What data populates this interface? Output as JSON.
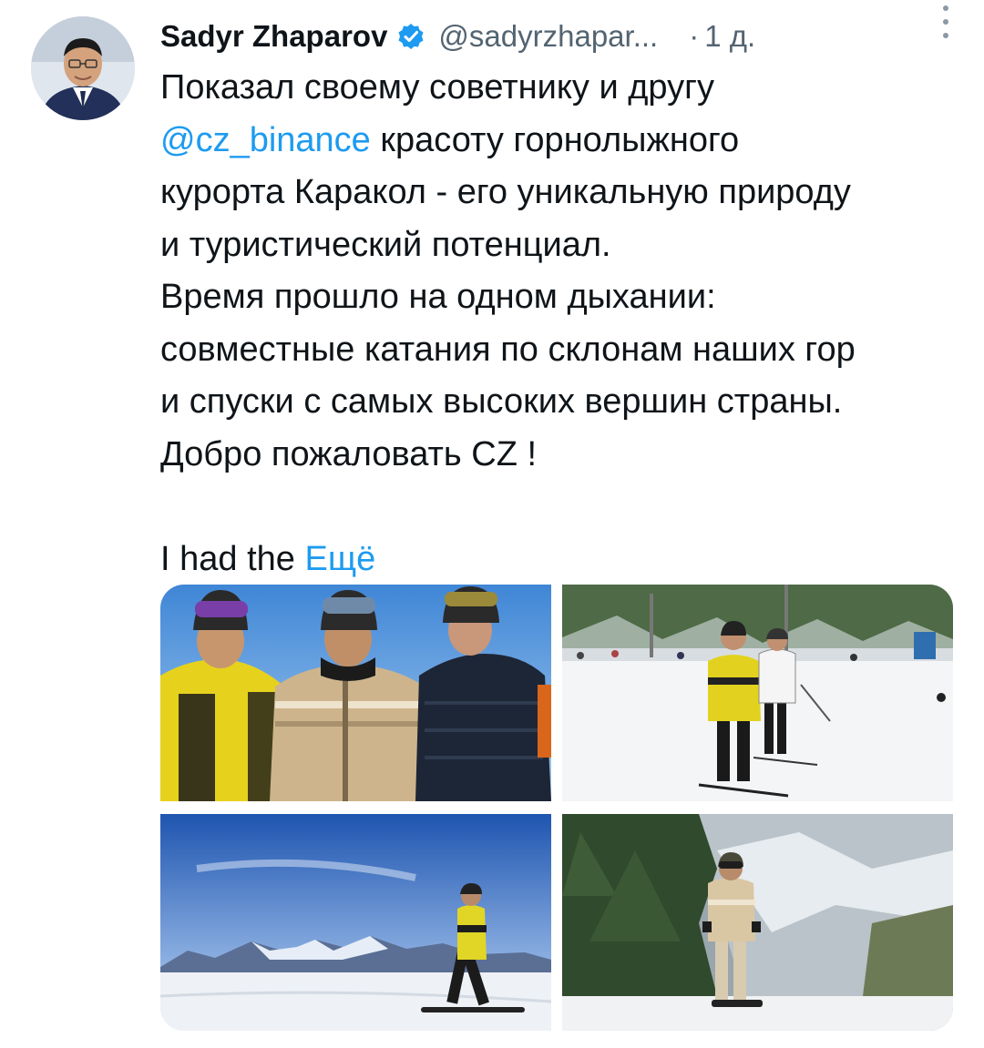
{
  "tweet": {
    "author_name": "Sadyr Zhaparov",
    "handle": "@sadyrzhapar...",
    "separator": "·",
    "time": "1 д.",
    "text_lines": [
      "Показал своему советнику и другу",
      "красоту горнолыжного",
      "курорта Каракол - его уникальную природу",
      "и туристический потенциал.",
      "Время прошло на одном дыхании:",
      "совместные катания по склонам наших гор",
      "и спуски с самых высоких вершин страны.",
      "Добро пожаловать CZ !"
    ],
    "mention": "@cz_binance",
    "english_preview": "I had the",
    "show_more": "Ещё"
  },
  "icons": {
    "verified": "verified-badge-icon",
    "more": "more-vertical-icon"
  },
  "colors": {
    "link": "#1d9bf0",
    "secondary_text": "#536471",
    "primary_text": "#0f1419"
  },
  "media": [
    {
      "description_name": "three-skiers-photo"
    },
    {
      "description_name": "ski-slope-photo"
    },
    {
      "description_name": "snowboarder-mountains-photo"
    },
    {
      "description_name": "snowboarder-forest-photo"
    }
  ]
}
